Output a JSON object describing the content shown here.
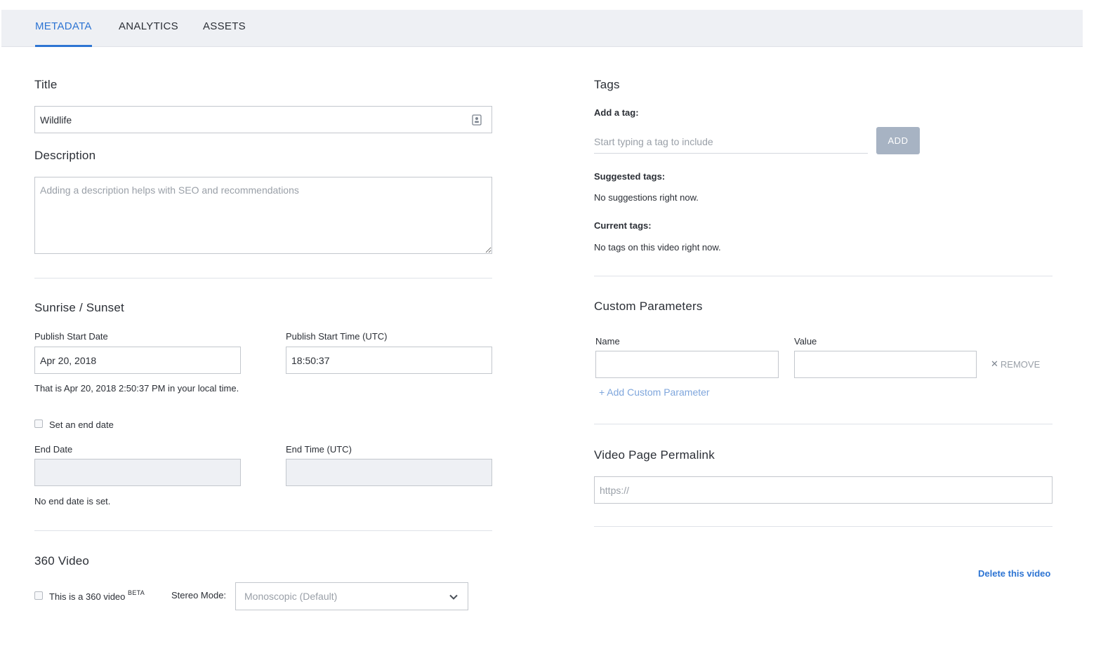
{
  "tabs": [
    {
      "label": "METADATA",
      "active": true
    },
    {
      "label": "ANALYTICS",
      "active": false
    },
    {
      "label": "ASSETS",
      "active": false
    }
  ],
  "title_section": {
    "heading": "Title",
    "value": "Wildlife"
  },
  "description_section": {
    "heading": "Description",
    "placeholder": "Adding a description helps with SEO and recommendations"
  },
  "sunrise": {
    "heading": "Sunrise / Sunset",
    "publish_start_date_label": "Publish Start Date",
    "publish_start_date_value": "Apr 20, 2018",
    "publish_start_time_label": "Publish Start Time (UTC)",
    "publish_start_time_value": "18:50:37",
    "local_time_note": "That is Apr 20, 2018 2:50:37 PM in your local time.",
    "set_end_date_label": "Set an end date",
    "end_date_label": "End Date",
    "end_time_label": "End Time (UTC)",
    "no_end_date_note": "No end date is set."
  },
  "video360": {
    "heading": "360 Video",
    "checkbox_label": "This is a 360 video",
    "beta_badge": "BETA",
    "stereo_mode_label": "Stereo Mode:",
    "stereo_mode_value": "Monoscopic (Default)"
  },
  "tags": {
    "heading": "Tags",
    "add_tag_label": "Add a tag:",
    "add_tag_placeholder": "Start typing a tag to include",
    "add_button": "ADD",
    "suggested_label": "Suggested tags:",
    "suggested_note": "No suggestions right now.",
    "current_label": "Current tags:",
    "current_note": "No tags on this video right now."
  },
  "custom_params": {
    "heading": "Custom Parameters",
    "name_label": "Name",
    "value_label": "Value",
    "remove_label": "REMOVE",
    "add_link": "+ Add Custom Parameter"
  },
  "permalink": {
    "heading": "Video Page Permalink",
    "placeholder": "https://"
  },
  "delete_link": "Delete this video",
  "colors": {
    "accent": "#2d74d3",
    "tabbar_bg": "#eef0f4",
    "add_button_bg": "#a7b3c3"
  }
}
